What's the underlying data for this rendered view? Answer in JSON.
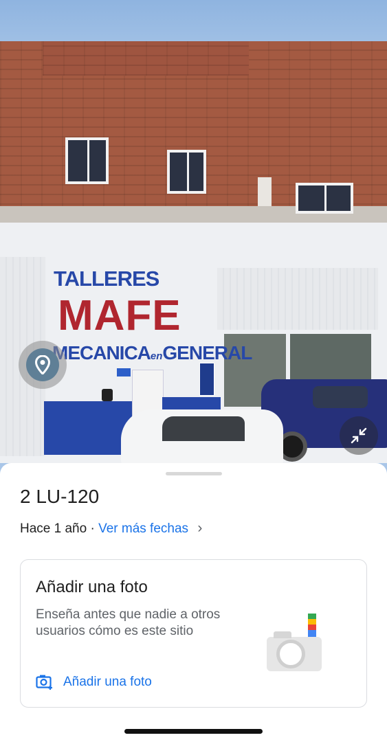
{
  "sign": {
    "line1": "TALLERES",
    "line2": "MAFE",
    "line3_a": "MECANICA",
    "line3_b": "en",
    "line3_c": "GENERAL"
  },
  "icons": {
    "location": "location-pin-icon",
    "collapse": "collapse-icon",
    "add_photo": "add-photo-icon",
    "chevron": "chevron-right-icon"
  },
  "place": {
    "title": "2 LU-120",
    "date_text": "Hace 1 año",
    "separator": " · ",
    "more_dates": "Ver más fechas",
    "chevron": "›"
  },
  "add_photo_card": {
    "title": "Añadir una foto",
    "description": "Enseña antes que nadie a otros usuarios cómo es este sitio",
    "action_label": "Añadir una foto"
  },
  "colors": {
    "link": "#1a73e8",
    "sign_blue": "#2748a8",
    "sign_red": "#b0262f"
  }
}
